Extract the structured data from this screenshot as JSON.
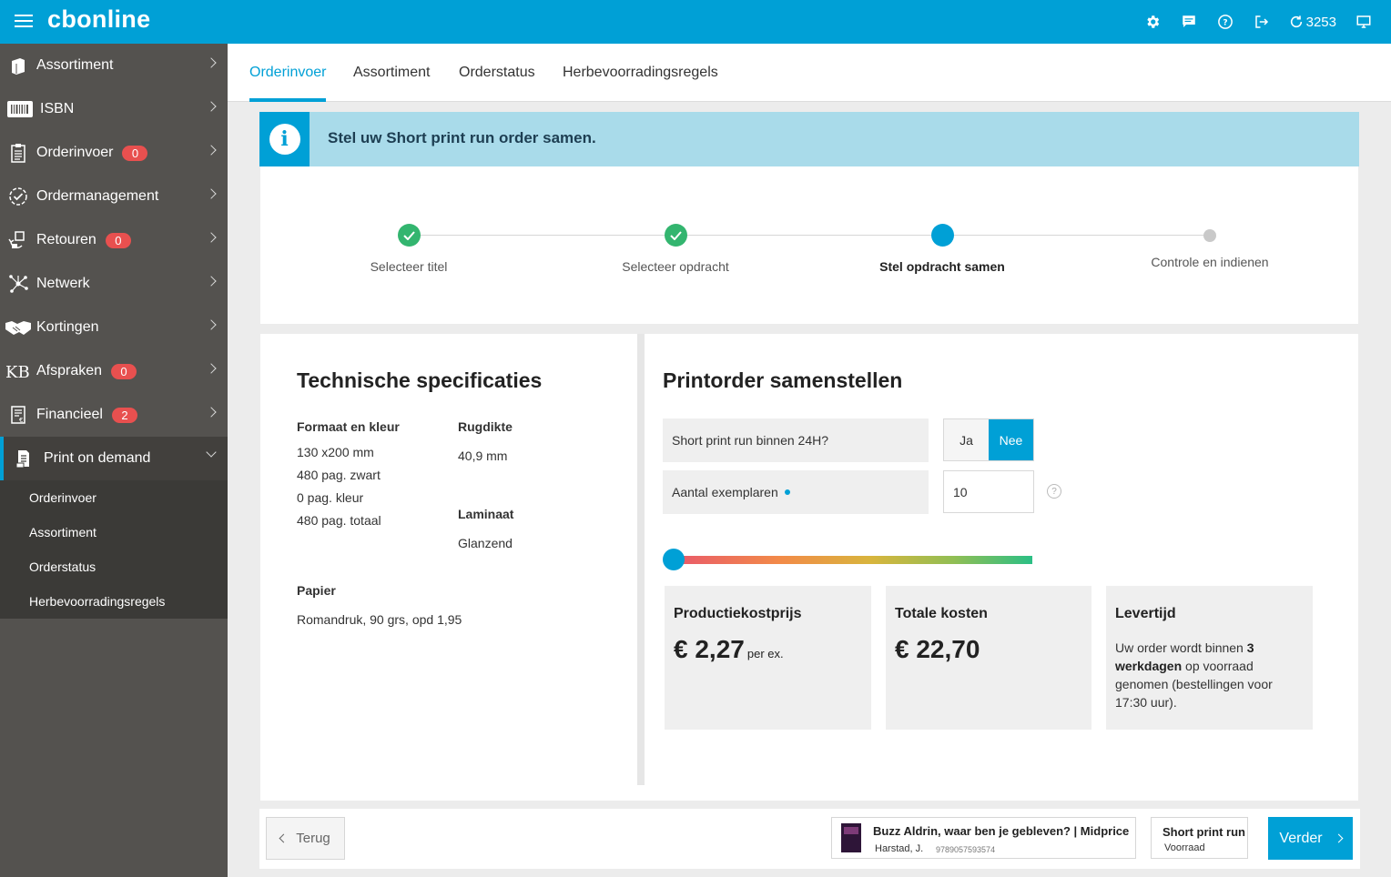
{
  "app": {
    "logo": "cbonline",
    "counter": "3253"
  },
  "topbar_icons": [
    "gear-icon",
    "chat-icon",
    "help-icon",
    "logout-icon",
    "refresh-icon",
    "monitor-icon"
  ],
  "sidebar": {
    "items": [
      {
        "label": "Assortiment",
        "icon": "book-icon"
      },
      {
        "label": "ISBN",
        "icon": "barcode-icon"
      },
      {
        "label": "Orderinvoer",
        "icon": "clipboard-icon",
        "badge": "0"
      },
      {
        "label": "Ordermanagement",
        "icon": "check-circle-icon"
      },
      {
        "label": "Retouren",
        "icon": "return-icon",
        "badge": "0"
      },
      {
        "label": "Netwerk",
        "icon": "network-icon"
      },
      {
        "label": "Kortingen",
        "icon": "handshake-icon"
      },
      {
        "label": "Afspraken",
        "icon": "kb-logo-icon",
        "badge": "0"
      },
      {
        "label": "Financieel",
        "icon": "invoice-icon",
        "badge": "2"
      },
      {
        "label": "Print on demand",
        "icon": "print-icon"
      }
    ],
    "subitems": [
      "Orderinvoer",
      "Assortiment",
      "Orderstatus",
      "Herbevoorradingsregels"
    ]
  },
  "tabs": [
    "Orderinvoer",
    "Assortiment",
    "Orderstatus",
    "Herbevoorradingsregels"
  ],
  "banner": {
    "text": "Stel uw Short print run order samen."
  },
  "steps": [
    "Selecteer titel",
    "Selecteer opdracht",
    "Stel opdracht samen",
    "Controle en indienen"
  ],
  "specs": {
    "title": "Technische specificaties",
    "format_label": "Formaat en kleur",
    "format_lines": [
      "130 x200 mm",
      "480 pag. zwart",
      "0 pag. kleur",
      "480 pag. totaal"
    ],
    "spine_label": "Rugdikte",
    "spine_value": "40,9 mm",
    "laminate_label": "Laminaat",
    "laminate_value": "Glanzend",
    "paper_label": "Papier",
    "paper_value": "Romandruk, 90 grs, opd 1,95"
  },
  "order": {
    "title": "Printorder samenstellen",
    "rush_label": "Short print run binnen 24H?",
    "yes": "Ja",
    "no": "Nee",
    "qty_label": "Aantal exemplaren",
    "qty_value": "10",
    "help": "?",
    "slider_fraction": 0.0,
    "cost_title": "Productiekostprijs",
    "cost_value": "€ 2,27",
    "cost_unit": "per ex.",
    "total_title": "Totale kosten",
    "total_value": "€ 22,70",
    "delivery_title": "Levertijd",
    "delivery_pre": "Uw order wordt binnen ",
    "delivery_bold": "3 werkdagen",
    "delivery_post": " op voorraad genomen (bestellingen voor 17:30 uur)."
  },
  "footer": {
    "back": "Terug",
    "book_title": "Buzz Aldrin, waar ben je gebleven? | Midprice",
    "book_author": "Harstad, J.",
    "book_isbn": "9789057593574",
    "type_title": "Short print run",
    "type_sub": "Voorraad",
    "next": "Verder"
  },
  "colors": {
    "accent": "#00a0d6",
    "sidebar": "#54524f",
    "success": "#33b56f",
    "badge": "#e8504f"
  }
}
